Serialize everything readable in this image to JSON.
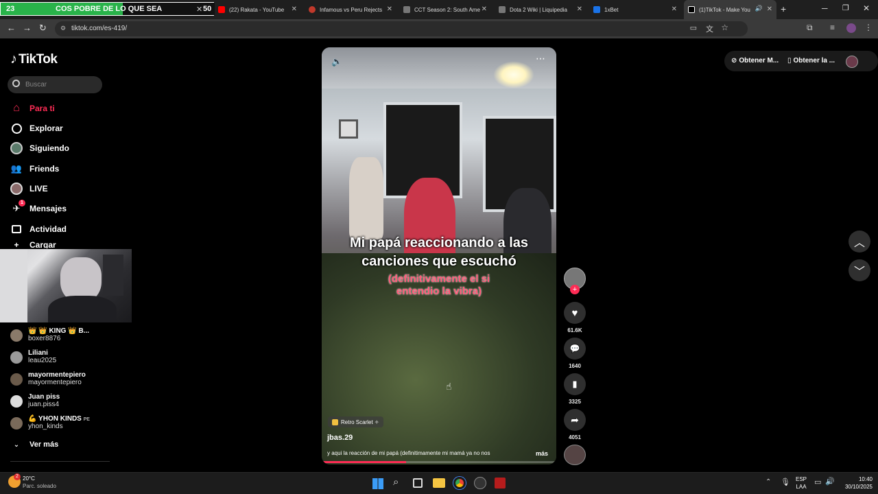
{
  "browser": {
    "overlay": {
      "left_num": "23",
      "text": "COS POBRE DE LO QUE SEA",
      "right_num": "50"
    },
    "tabs": [
      {
        "label": "(22) Rakata - YouTube",
        "color": "#ff0000"
      },
      {
        "label": "Infamous vs Peru Rejects",
        "color": "#c0392b"
      },
      {
        "label": "CCT Season 2: South Ame",
        "color": "#cccccc"
      },
      {
        "label": "Dota 2 Wiki | Liquipedia",
        "color": "#cccccc"
      },
      {
        "label": "1xBet",
        "color": "#1a73e8"
      },
      {
        "label": "(1)TikTok - Make You",
        "color": "#ffffff"
      }
    ],
    "url": "tiktok.com/es-419/"
  },
  "sidebar": {
    "logo": "TikTok",
    "search_placeholder": "Buscar",
    "nav": [
      {
        "label": "Para ti",
        "icon": "home-icon",
        "color": "#fe2c55"
      },
      {
        "label": "Explorar",
        "icon": "compass-icon",
        "color": "#ffffff"
      },
      {
        "label": "Siguiendo",
        "icon": "following-icon",
        "color": "#ffffff"
      },
      {
        "label": "Friends",
        "icon": "friends-icon",
        "color": "#ffffff"
      },
      {
        "label": "LIVE",
        "icon": "live-icon",
        "color": "#ffffff"
      },
      {
        "label": "Mensajes",
        "icon": "messages-icon",
        "color": "#ffffff",
        "badge": "1"
      },
      {
        "label": "Actividad",
        "icon": "activity-icon",
        "color": "#ffffff"
      }
    ],
    "partial_label": "Cargar",
    "following": [
      {
        "name": "👑 👑 KING 👑 B...",
        "handle": "boxer8876"
      },
      {
        "name": "Liliani",
        "handle": "leau2025"
      },
      {
        "name": "mayormentepiero",
        "handle": "mayormentepiero"
      },
      {
        "name": "Juan piss",
        "handle": "juan.piss4"
      },
      {
        "name": "💪 YHON KINDS",
        "handle": "yhon_kinds",
        "suffix": "PE"
      }
    ],
    "see_more": "Ver más"
  },
  "video": {
    "caption_line1": "Mi papá reaccionando a las",
    "caption_line2": "canciones que escuchó",
    "caption_pink1": "(definitivamente el si",
    "caption_pink2": "entendio la vibra)",
    "music_tag": "Retro Scarlet ✧",
    "author": "jbas.29",
    "description": "y aqui la reacción de mi papá (definitimamente mi mamá ya no nos",
    "more": "más",
    "progress": 0.36
  },
  "actions": {
    "likes": "61.6K",
    "comments": "1640",
    "saves": "3325",
    "shares": "4051"
  },
  "header_buttons": {
    "get_coins": "Obtener M...",
    "get_app": "Obtener la ..."
  },
  "taskbar": {
    "weather_temp": "20°C",
    "weather_desc": "Parc. soleado",
    "weather_badge": "2",
    "lang1": "ESP",
    "lang2": "LAA",
    "time": "10:40",
    "date": "30/10/2025"
  }
}
